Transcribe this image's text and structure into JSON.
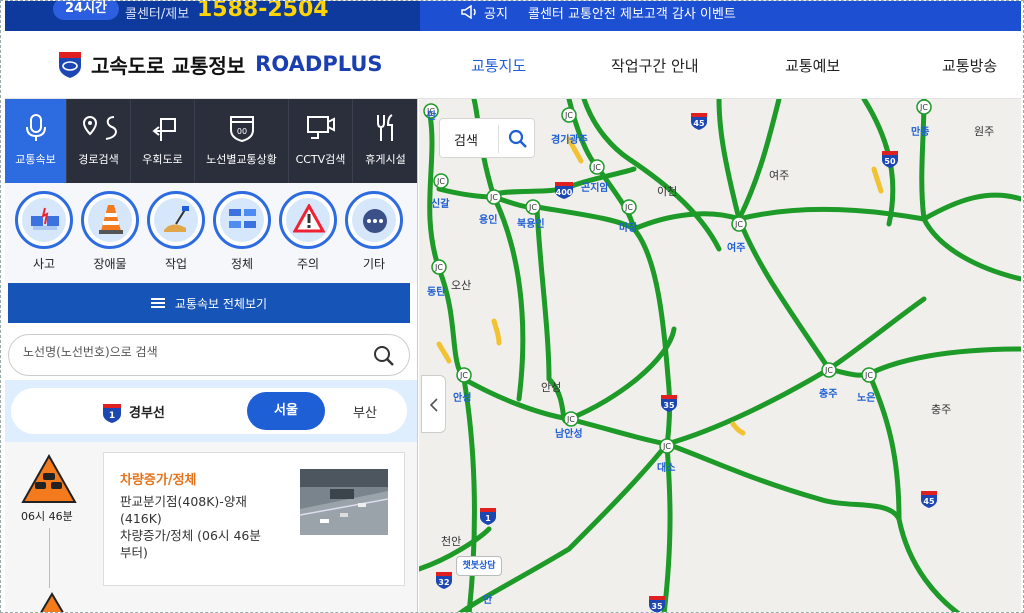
{
  "topbar": {
    "badge": "24시간",
    "callcenter_label": "콜센터/제보",
    "callcenter_number": "1588-2504",
    "notice_label": "공지",
    "notice_text": "콜센터 교통안전 제보고객 감사 이벤트"
  },
  "header": {
    "logo_kr": "고속도로 교통정보",
    "logo_en": "ROADPLUS",
    "nav": [
      "교통지도",
      "작업구간 안내",
      "교통예보",
      "교통방송"
    ],
    "active_nav": "교통지도"
  },
  "sidebar": {
    "icon_tabs": [
      "교통속보",
      "경로검색",
      "우회도로",
      "노선별교통상황",
      "CCTV검색",
      "휴게시설"
    ],
    "active_tab": "교통속보",
    "categories": [
      "사고",
      "장애물",
      "작업",
      "정체",
      "주의",
      "기타"
    ],
    "all_button": "교통속보 전체보기",
    "search_placeholder": "노선명(노선번호)으로 검색",
    "route": {
      "shield": "1",
      "name": "경부선",
      "dir_active": "서울",
      "dir_other": "부산"
    },
    "event": {
      "time": "06시 46분",
      "title": "차량증가/정체",
      "desc_line1": "판교분기점(408K)-양재",
      "desc_line2": "(416K)",
      "desc_line3": "차량증가/정체 (06시 46분",
      "desc_line4": "부터)"
    }
  },
  "map": {
    "search_label": "검색",
    "chat_label": "챗봇상담",
    "jc_label": "JC",
    "places": [
      {
        "name": "원주",
        "style": "region"
      },
      {
        "name": "여주",
        "style": "region"
      },
      {
        "name": "이천",
        "style": "region"
      },
      {
        "name": "오산",
        "style": "region"
      },
      {
        "name": "안성",
        "style": "region"
      },
      {
        "name": "충주",
        "style": "region"
      },
      {
        "name": "천안",
        "style": "region"
      },
      {
        "name": "경기광주",
        "style": "ic"
      },
      {
        "name": "곤지암",
        "style": "ic"
      },
      {
        "name": "신갈",
        "style": "ic"
      },
      {
        "name": "용인",
        "style": "ic"
      },
      {
        "name": "북용인",
        "style": "ic"
      },
      {
        "name": "마장",
        "style": "ic"
      },
      {
        "name": "여주",
        "style": "ic"
      },
      {
        "name": "만종",
        "style": "ic"
      },
      {
        "name": "동탄",
        "style": "ic"
      },
      {
        "name": "안성",
        "style": "ic"
      },
      {
        "name": "남안성",
        "style": "ic"
      },
      {
        "name": "대소",
        "style": "ic"
      },
      {
        "name": "충주",
        "style": "ic"
      },
      {
        "name": "노은",
        "style": "ic"
      },
      {
        "name": "판",
        "style": "ic"
      },
      {
        "name": "안",
        "style": "ic"
      }
    ],
    "shields": [
      "45",
      "50",
      "400",
      "35",
      "45",
      "1",
      "32",
      "35"
    ]
  },
  "colors": {
    "accent": "#1f5fd6",
    "road": "#1e9a28",
    "dark_bar": "#2a2f3b"
  }
}
